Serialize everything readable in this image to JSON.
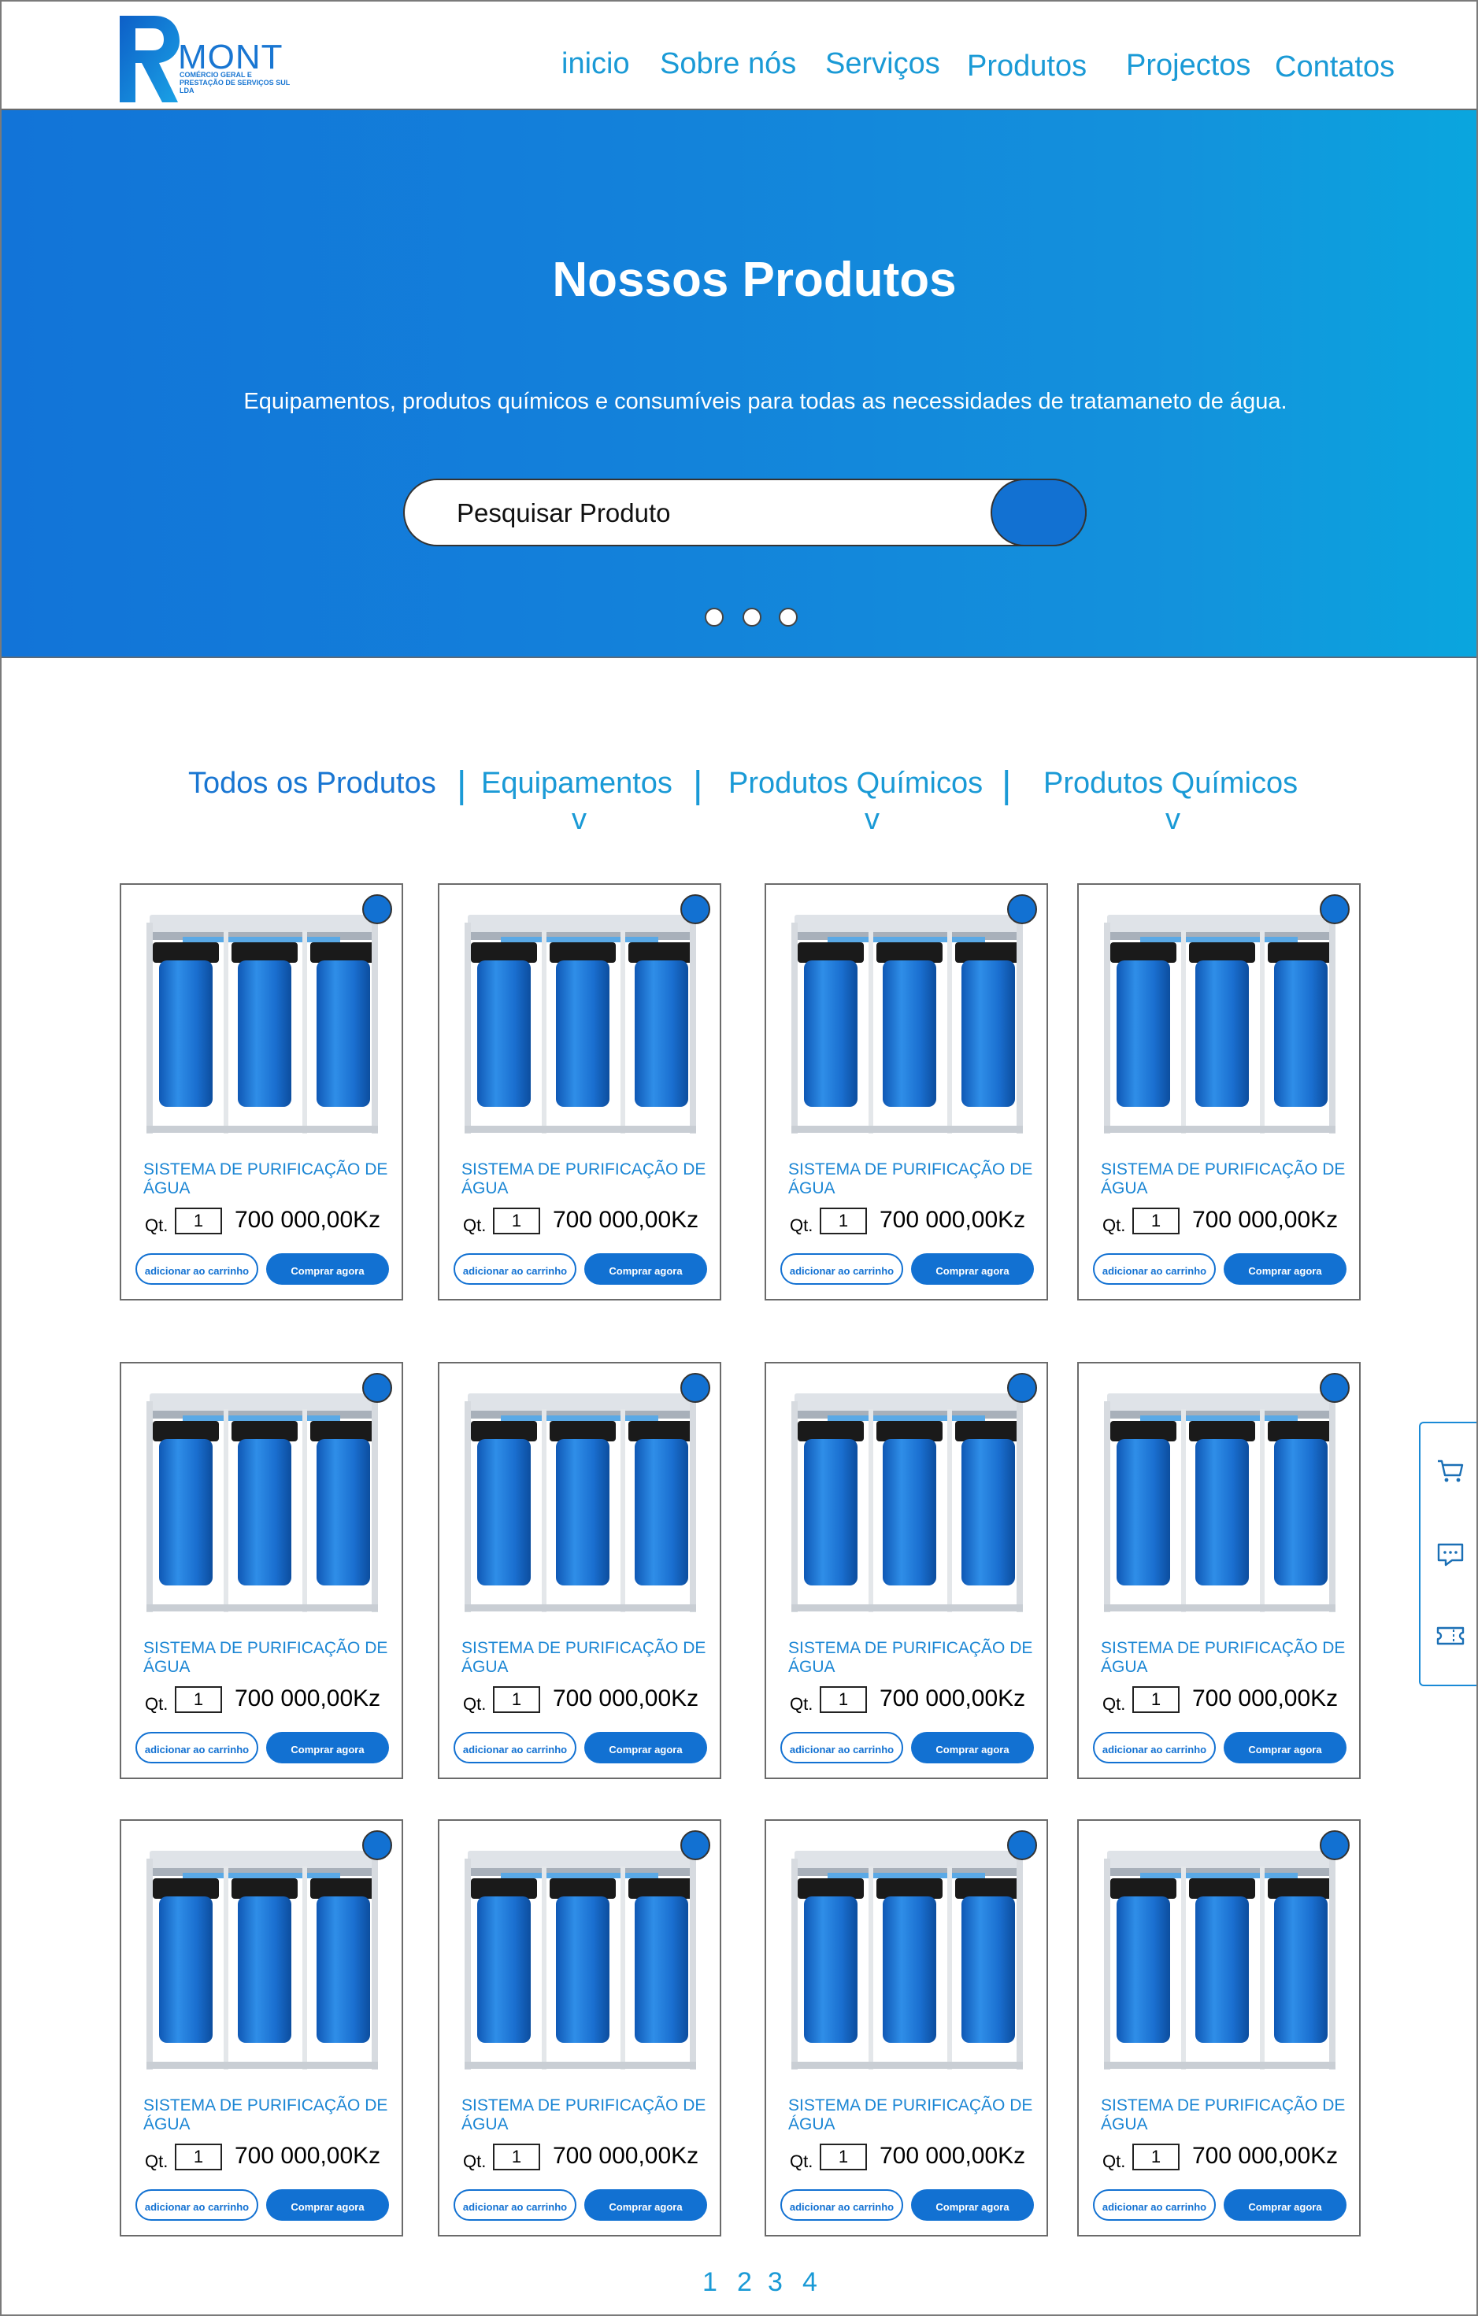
{
  "brand": {
    "logo_letter": "R",
    "name": "MONT",
    "subtitle": "COMÉRCIO GERAL E PRESTAÇÃO DE SERVIÇOS SUL LDA"
  },
  "nav": [
    "inicio",
    "Sobre nós",
    "Serviços",
    "Produtos",
    "Projectos",
    "Contatos"
  ],
  "hero": {
    "title": "Nossos Produtos",
    "subtitle": "Equipamentos, produtos químicos e consumíveis para todas as necessidades de tratamaneto de água.",
    "search_placeholder": "Pesquisar Produto",
    "carousel_dots": 3
  },
  "categories": {
    "items": [
      "Todos os Produtos",
      "Equipamentos",
      "Produtos Químicos",
      "Produtos Químicos"
    ],
    "separator": "|",
    "chevron": "v"
  },
  "product_card": {
    "qty_label": "Qt.",
    "add_to_cart": "adicionar ao carrinho",
    "buy_now": "Comprar agora"
  },
  "products": [
    {
      "name": "SISTEMA DE PURIFICAÇÃO DE ÁGUA",
      "qty": "1",
      "price": "700 000,00Kz"
    },
    {
      "name": "SISTEMA DE PURIFICAÇÃO DE ÁGUA",
      "qty": "1",
      "price": "700 000,00Kz"
    },
    {
      "name": "SISTEMA DE PURIFICAÇÃO DE ÁGUA",
      "qty": "1",
      "price": "700 000,00Kz"
    },
    {
      "name": "SISTEMA DE PURIFICAÇÃO DE ÁGUA",
      "qty": "1",
      "price": "700 000,00Kz"
    },
    {
      "name": "SISTEMA DE PURIFICAÇÃO DE ÁGUA",
      "qty": "1",
      "price": "700 000,00Kz"
    },
    {
      "name": "SISTEMA DE PURIFICAÇÃO DE ÁGUA",
      "qty": "1",
      "price": "700 000,00Kz"
    },
    {
      "name": "SISTEMA DE PURIFICAÇÃO DE ÁGUA",
      "qty": "1",
      "price": "700 000,00Kz"
    },
    {
      "name": "SISTEMA DE PURIFICAÇÃO DE ÁGUA",
      "qty": "1",
      "price": "700 000,00Kz"
    },
    {
      "name": "SISTEMA DE PURIFICAÇÃO DE ÁGUA",
      "qty": "1",
      "price": "700 000,00Kz"
    },
    {
      "name": "SISTEMA DE PURIFICAÇÃO DE ÁGUA",
      "qty": "1",
      "price": "700 000,00Kz"
    },
    {
      "name": "SISTEMA DE PURIFICAÇÃO DE ÁGUA",
      "qty": "1",
      "price": "700 000,00Kz"
    },
    {
      "name": "SISTEMA DE PURIFICAÇÃO DE ÁGUA",
      "qty": "1",
      "price": "700 000,00Kz"
    }
  ],
  "side_panel": [
    "cart-icon",
    "chat-icon",
    "ticket-icon"
  ],
  "pagination": [
    "1",
    "2",
    "3",
    "4"
  ],
  "colors": {
    "primary": "#1271d2",
    "accent": "#1a9ad6",
    "hero_start": "#1274d8",
    "hero_end": "#0aa6de",
    "filter_blue": "#2f7fd4"
  }
}
